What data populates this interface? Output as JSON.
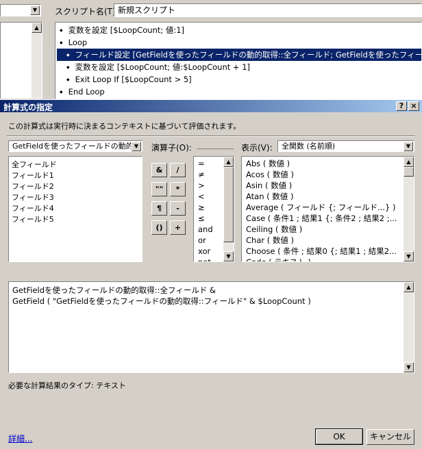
{
  "bg_window": {
    "script_name_label": "スクリプト名(T):",
    "script_name_value": "新規スクリプト",
    "script_lines": [
      {
        "text": "変数を設定 [$LoopCount; 値:1]",
        "indent": 0,
        "selected": false
      },
      {
        "text": "Loop",
        "indent": 0,
        "selected": false
      },
      {
        "text": "フィールド設定 [GetFieldを使ったフィールドの動的取得::全フィールド; GetFieldを使ったフィールドの動的取得::フィールド]",
        "indent": 1,
        "selected": true
      },
      {
        "text": "変数を設定 [$LoopCount; 値:$LoopCount + 1]",
        "indent": 1,
        "selected": false
      },
      {
        "text": "Exit Loop If [$LoopCount > 5]",
        "indent": 1,
        "selected": false
      },
      {
        "text": "End Loop",
        "indent": 0,
        "selected": false
      }
    ]
  },
  "dialog": {
    "title": "計算式の指定",
    "help_btn": "?",
    "close_btn": "×",
    "description": "この計算式は実行時に決まるコンテキストに基づいて評価されます。",
    "table_select": "GetFieldを使ったフィールドの動的取",
    "fields": [
      "全フィールド",
      "フィールド1",
      "フィールド2",
      "フィールド3",
      "フィールド4",
      "フィールド5"
    ],
    "operators_label": "演算子(O):",
    "op_buttons": [
      "&",
      "/",
      "\"\"",
      "*",
      "¶",
      "-",
      "()",
      "+"
    ],
    "operators": [
      "=",
      "≠",
      ">",
      "<",
      "≥",
      "≤",
      "and",
      "or",
      "xor",
      "not"
    ],
    "view_label": "表示(V):",
    "view_select": "全関数 (名前順)",
    "functions": [
      "Abs ( 数値 )",
      "Acos ( 数値 )",
      "Asin ( 数値 )",
      "Atan ( 数値 )",
      "Average ( フィールド {; フィールド...} )",
      "Case ( 条件1 ; 結果1 {; 条件2 ; 結果2 ;...",
      "Ceiling ( 数値 )",
      "Char ( 数値 )",
      "Choose ( 条件 ; 結果0 {; 結果1 ; 結果2...",
      "Code ( テキスト )"
    ],
    "formula_lines": [
      "GetFieldを使ったフィールドの動的取得::全フィールド &",
      "GetField ( \"GetFieldを使ったフィールドの動的取得::フィールド\" & $LoopCount )"
    ],
    "result_type": "必要な計算結果のタイプ: テキスト",
    "details_link": "詳細...",
    "ok": "OK",
    "cancel": "キャンセル"
  },
  "colors": {
    "selection": "#0a246a",
    "title_gradient_start": "#0a246a",
    "title_gradient_end": "#a6caf0"
  }
}
